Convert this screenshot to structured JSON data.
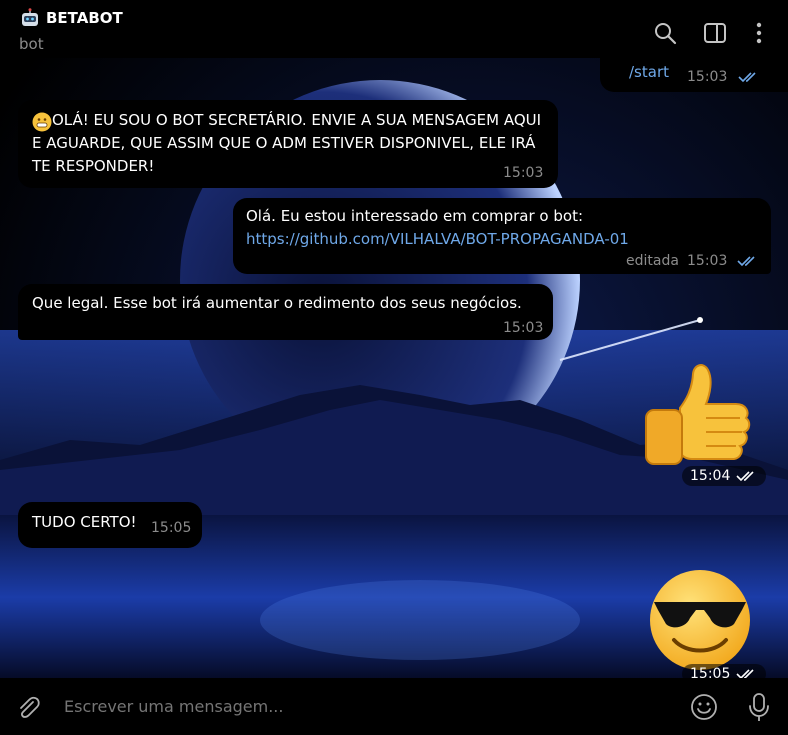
{
  "header": {
    "title": "BETABOT",
    "subtitle": "bot",
    "icons": [
      "bot-emoji-icon",
      "search-icon",
      "sidebar-toggle-icon",
      "more-vertical-icon"
    ]
  },
  "messages": {
    "m1": {
      "text": "/start",
      "time": "15:03",
      "status": "read"
    },
    "m2": {
      "line1": "OLÁ! EU SOU O BOT SECRETÁRIO. ENVIE A SUA MENSAGEM AQUI",
      "line2": "E AGUARDE, QUE ASSIM QUE O ADM ESTIVER DISPONIVEL, ELE IRÁ",
      "line3": "TE RESPONDER!",
      "time": "15:03"
    },
    "m3": {
      "text": "Olá. Eu estou interessado em comprar o bot:",
      "link": "https://github.com/VILHALVA/BOT-PROPAGANDA-01",
      "edited": "editada",
      "time": "15:03",
      "status": "read"
    },
    "m4": {
      "text": "Que legal. Esse bot irá aumentar o redimento dos seus negócios.",
      "time": "15:03"
    },
    "m5": {
      "sticker": "thumbs-up-sticker",
      "time": "15:04",
      "status": "read"
    },
    "m6": {
      "text": "TUDO CERTO!",
      "time": "15:05"
    },
    "m7": {
      "sticker": "sunglasses-face-sticker",
      "time": "15:05"
    }
  },
  "composer": {
    "placeholder": "Escrever uma mensagem...",
    "icons": [
      "attach-icon",
      "emoji-icon",
      "microphone-icon"
    ]
  },
  "colors": {
    "link": "#6fa8e8",
    "tick": "#6fa8e8",
    "muted": "#8c8c8c"
  }
}
